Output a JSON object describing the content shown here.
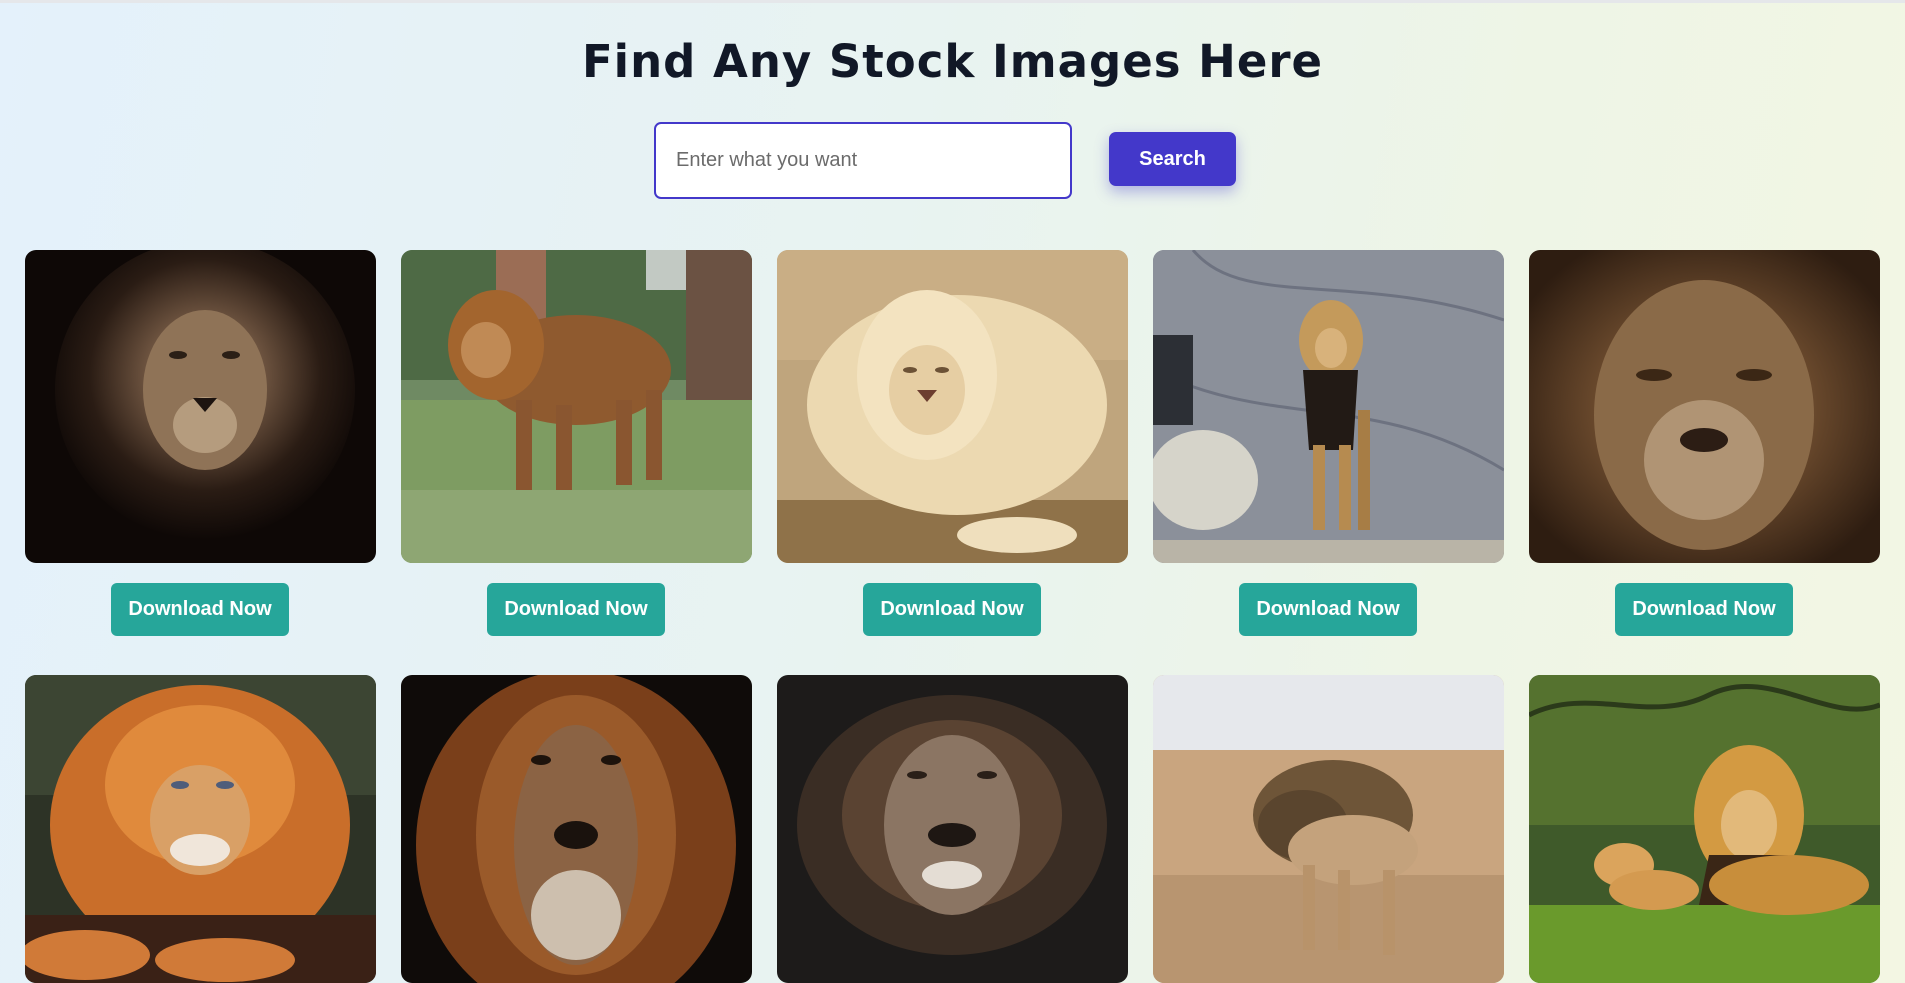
{
  "header": {
    "title": "Find Any Stock Images Here"
  },
  "search": {
    "placeholder": "Enter what you want",
    "button_label": "Search"
  },
  "results": {
    "download_label": "Download Now",
    "images": [
      {
        "subject": "lion-portrait-sepia"
      },
      {
        "subject": "lion-walking-grass"
      },
      {
        "subject": "white-lion-lying"
      },
      {
        "subject": "lion-standing-rock-wall"
      },
      {
        "subject": "lion-face-closeup"
      },
      {
        "subject": "lion-lying-orange-mane"
      },
      {
        "subject": "lion-dark-portrait"
      },
      {
        "subject": "lion-dark-scarred-face"
      },
      {
        "subject": "lion-in-savanna-grass"
      },
      {
        "subject": "lion-with-cub-forest"
      }
    ]
  },
  "colors": {
    "primary": "#4338ca",
    "download": "#26a69a",
    "title": "#111827"
  }
}
